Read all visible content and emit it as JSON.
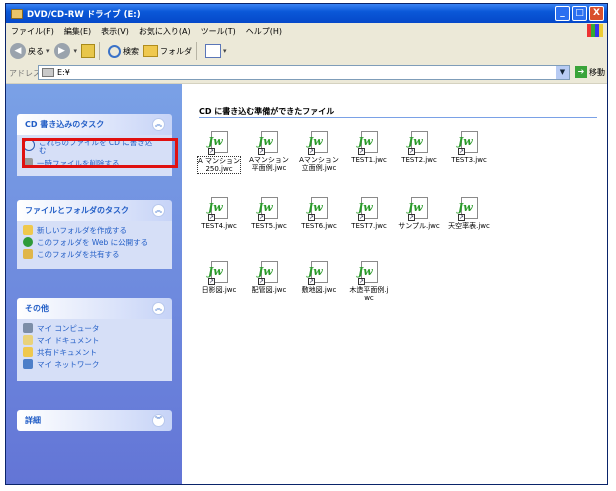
{
  "window": {
    "title": "DVD/CD-RW ドライブ (E:)",
    "buttons": {
      "minimize": "_",
      "maximize": "□",
      "close": "X"
    }
  },
  "menu": [
    "ファイル(F)",
    "編集(E)",
    "表示(V)",
    "お気に入り(A)",
    "ツール(T)",
    "ヘルプ(H)"
  ],
  "toolbar": {
    "back": "戻る",
    "search": "検索",
    "folders": "フォルダ"
  },
  "address": {
    "label": "アドレス(D)",
    "value": "E:¥",
    "go": "移動"
  },
  "sidebar": {
    "cd_tasks": {
      "title": "CD 書き込みのタスク",
      "items": [
        {
          "label": "これらのファイルを CD に書き込む"
        },
        {
          "label": "一時ファイルを削除する"
        }
      ]
    },
    "file_tasks": {
      "title": "ファイルとフォルダのタスク",
      "items": [
        {
          "label": "新しいフォルダを作成する"
        },
        {
          "label": "このフォルダを Web に公開する"
        },
        {
          "label": "このフォルダを共有する"
        }
      ]
    },
    "other": {
      "title": "その他",
      "items": [
        {
          "label": "マイ コンピュータ"
        },
        {
          "label": "マイ ドキュメント"
        },
        {
          "label": "共有ドキュメント"
        },
        {
          "label": "マイ ネットワーク"
        }
      ]
    },
    "details": {
      "title": "詳細"
    }
  },
  "main": {
    "group_title": "CD に書き込む準備ができたファイル",
    "files": [
      {
        "name": "A マンション250.jwc"
      },
      {
        "name": "Aマンション平面例.jwc"
      },
      {
        "name": "Aマンション立面例.jwc"
      },
      {
        "name": "TEST1.jwc"
      },
      {
        "name": "TEST2.jwc"
      },
      {
        "name": "TEST3.jwc"
      },
      {
        "name": "TEST4.jwc"
      },
      {
        "name": "TEST5.jwc"
      },
      {
        "name": "TEST6.jwc"
      },
      {
        "name": "TEST7.jwc"
      },
      {
        "name": "サンプル.jwc"
      },
      {
        "name": "天空率表.jwc"
      },
      {
        "name": "日影図.jwc"
      },
      {
        "name": "配管図.jwc"
      },
      {
        "name": "敷地図.jwc"
      },
      {
        "name": "木造平面例.jwc"
      }
    ]
  },
  "colors": {
    "title_bar": "#0a58d8",
    "sidebar_bg": "#6f8fe0",
    "link": "#215dc6",
    "highlight": "#e01010"
  }
}
